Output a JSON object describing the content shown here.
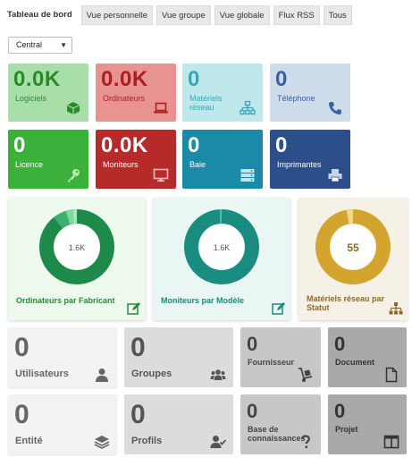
{
  "tabs": [
    {
      "label": "Tableau de bord",
      "active": true
    },
    {
      "label": "Vue personnelle",
      "active": false
    },
    {
      "label": "Vue groupe",
      "active": false
    },
    {
      "label": "Vue globale",
      "active": false
    },
    {
      "label": "Flux RSS",
      "active": false
    },
    {
      "label": "Tous",
      "active": false
    }
  ],
  "select": {
    "value": "Central"
  },
  "cards_row1": [
    {
      "value": "0.0K",
      "label": "Logiciels",
      "icon": "box-icon",
      "bg": "#a8dfa8",
      "fg": "#2a8a2a"
    },
    {
      "value": "0.0K",
      "label": "Ordinateurs",
      "icon": "laptop-icon",
      "bg": "#e89292",
      "fg": "#a82020"
    },
    {
      "value": "0",
      "label": "Matériels réseau",
      "icon": "network-icon",
      "bg": "#bfe8ec",
      "fg": "#3aa6b4"
    },
    {
      "value": "0",
      "label": "Téléphone",
      "icon": "phone-icon",
      "bg": "#cfdcec",
      "fg": "#3a62a0"
    }
  ],
  "cards_row2": [
    {
      "value": "0",
      "label": "Licence",
      "icon": "key-icon",
      "bg": "#3bb13b",
      "fg": "#ffffff"
    },
    {
      "value": "0.0K",
      "label": "Moniteurs",
      "icon": "monitor-icon",
      "bg": "#b62a2a",
      "fg": "#ffffff"
    },
    {
      "value": "0",
      "label": "Baie",
      "icon": "server-icon",
      "bg": "#1a8aa6",
      "fg": "#ffffff"
    },
    {
      "value": "0",
      "label": "Imprimantes",
      "icon": "printer-icon",
      "bg": "#2c4f8a",
      "fg": "#ffffff"
    }
  ],
  "donuts": [
    {
      "center": "1.6K",
      "label": "Ordinateurs par Fabricant",
      "bg": "#eef9ee",
      "fg": "#2a8a3a",
      "ring": "#1d8a4a",
      "icon": "edit-icon"
    },
    {
      "center": "1.6K",
      "label": "Moniteurs par Modèle",
      "bg": "#eaf6f3",
      "fg": "#1a8a78",
      "ring": "#1a8c80",
      "icon": "edit-icon"
    },
    {
      "center": "55",
      "label": "Matériels réseau par Statut",
      "bg": "#f5f1e6",
      "fg": "#8a6a2a",
      "ring": "#d4a52e",
      "icon": "sitemap-icon"
    }
  ],
  "bottom_left": [
    {
      "value": "0",
      "label": "Utilisateurs",
      "icon": "user-icon"
    },
    {
      "value": "0",
      "label": "Groupes",
      "icon": "users-icon"
    },
    {
      "value": "0",
      "label": "Entité",
      "icon": "layers-icon"
    },
    {
      "value": "0",
      "label": "Profils",
      "icon": "user-check-icon"
    }
  ],
  "bottom_right": [
    {
      "value": "0",
      "label": "Fournisseur",
      "icon": "dolly-icon"
    },
    {
      "value": "0",
      "label": "Document",
      "icon": "file-icon"
    },
    {
      "value": "0",
      "label": "Base de connaissances",
      "icon": "question-icon"
    },
    {
      "value": "0",
      "label": "Projet",
      "icon": "columns-icon"
    }
  ]
}
